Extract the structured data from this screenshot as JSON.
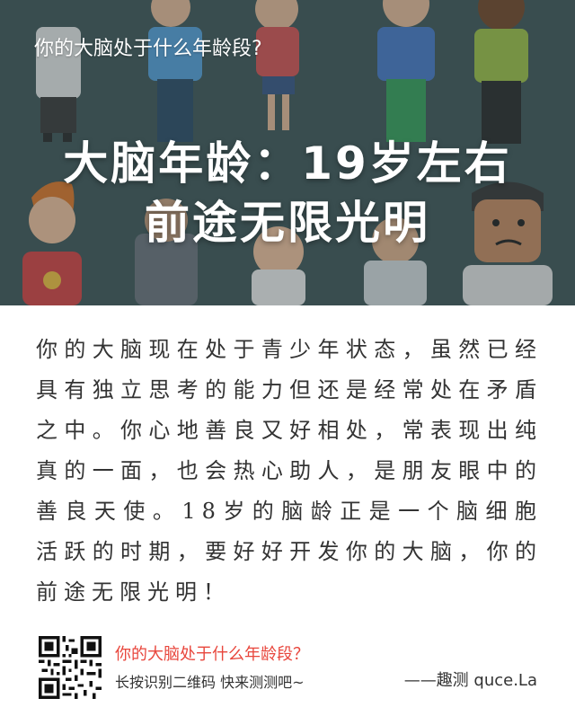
{
  "hero": {
    "question": "你的大脑处于什么年龄段?",
    "result_line1": "大脑年龄：19岁左右",
    "result_line2": "前途无限光明"
  },
  "description": "你的大脑现在处于青少年状态，虽然已经具有独立思考的能力但还是经常处在矛盾之中。你心地善良又好相处，常表现出纯真的一面，也会热心助人，是朋友眼中的善良天使。18岁的脑龄正是一个脑细胞活跃的时期，要好好开发你的大脑，你的前途无限光明！",
  "footer": {
    "title": "你的大脑处于什么年龄段？",
    "subtitle": "长按识别二维码  快来测测吧~",
    "brand": "——趣测 quce.La",
    "qr_icon": "qr-code-icon"
  },
  "colors": {
    "hero_bg": "#43595b",
    "accent_red": "#e8463c",
    "text": "#333333"
  }
}
